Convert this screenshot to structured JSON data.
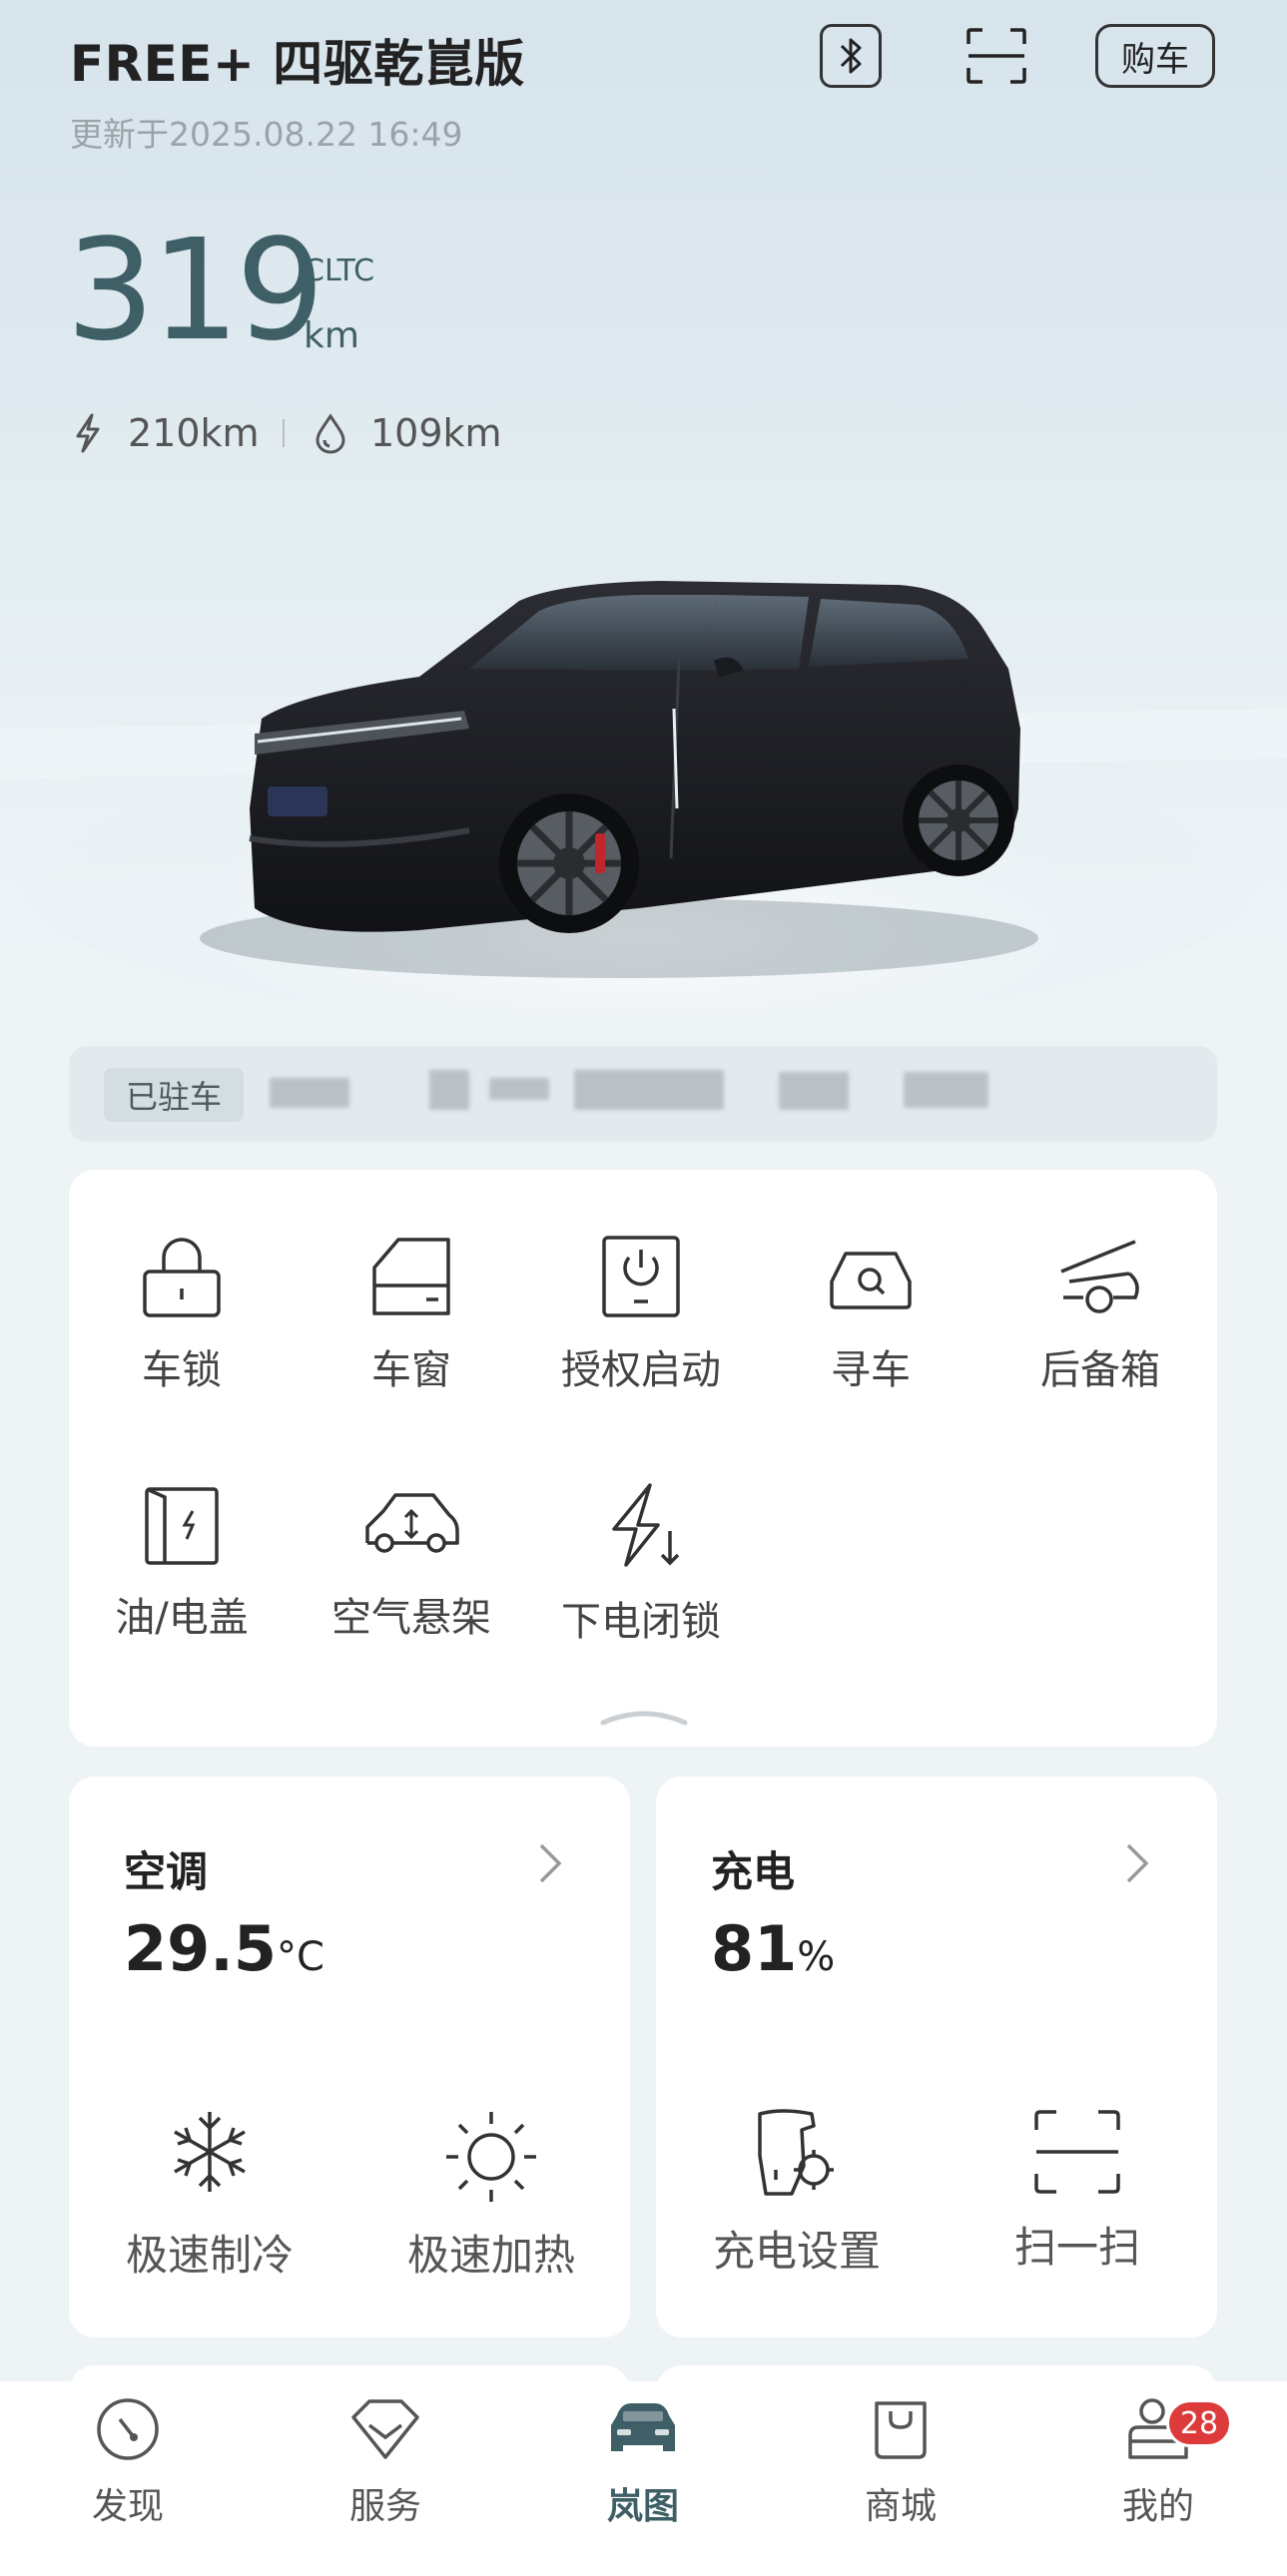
{
  "header": {
    "vehicle_name": "FREE+ 四驱乾崑版",
    "updated_time": "更新于2025.08.22 16:49",
    "bluetooth_icon": "bluetooth-icon",
    "scan_icon": "scan-icon",
    "buy_label": "购车"
  },
  "range": {
    "total": "319",
    "standard": "CLTC",
    "unit": "km",
    "electric": "210km",
    "fuel": "109km"
  },
  "parking": {
    "tag": "已驻车"
  },
  "controls": [
    {
      "label": "车锁",
      "icon": "lock-icon"
    },
    {
      "label": "车窗",
      "icon": "window-icon"
    },
    {
      "label": "授权启动",
      "icon": "power-icon"
    },
    {
      "label": "寻车",
      "icon": "find-car-icon"
    },
    {
      "label": "后备箱",
      "icon": "trunk-icon"
    },
    {
      "label": "油/电盖",
      "icon": "charge-port-icon"
    },
    {
      "label": "空气悬架",
      "icon": "air-suspension-icon"
    },
    {
      "label": "下电闭锁",
      "icon": "power-off-lock-icon"
    }
  ],
  "climate": {
    "title": "空调",
    "temperature": "29.5",
    "unit": "°C",
    "actions": [
      {
        "label": "极速制冷",
        "icon": "snowflake-icon"
      },
      {
        "label": "极速加热",
        "icon": "sun-icon"
      }
    ]
  },
  "charging": {
    "title": "充电",
    "level": "81",
    "unit": "%",
    "actions": [
      {
        "label": "充电设置",
        "icon": "charge-settings-icon"
      },
      {
        "label": "扫一扫",
        "icon": "scan-icon"
      }
    ]
  },
  "tabs": [
    {
      "label": "发现",
      "icon": "compass-icon",
      "active": false
    },
    {
      "label": "服务",
      "icon": "diamond-icon",
      "active": false
    },
    {
      "label": "岚图",
      "icon": "car-front-icon",
      "active": true
    },
    {
      "label": "商城",
      "icon": "bag-icon",
      "active": false
    },
    {
      "label": "我的",
      "icon": "profile-icon",
      "active": false,
      "badge": "28"
    }
  ],
  "colors": {
    "accent": "#3f5f66",
    "badge": "#dd3b3b",
    "card": "#ffffff"
  }
}
